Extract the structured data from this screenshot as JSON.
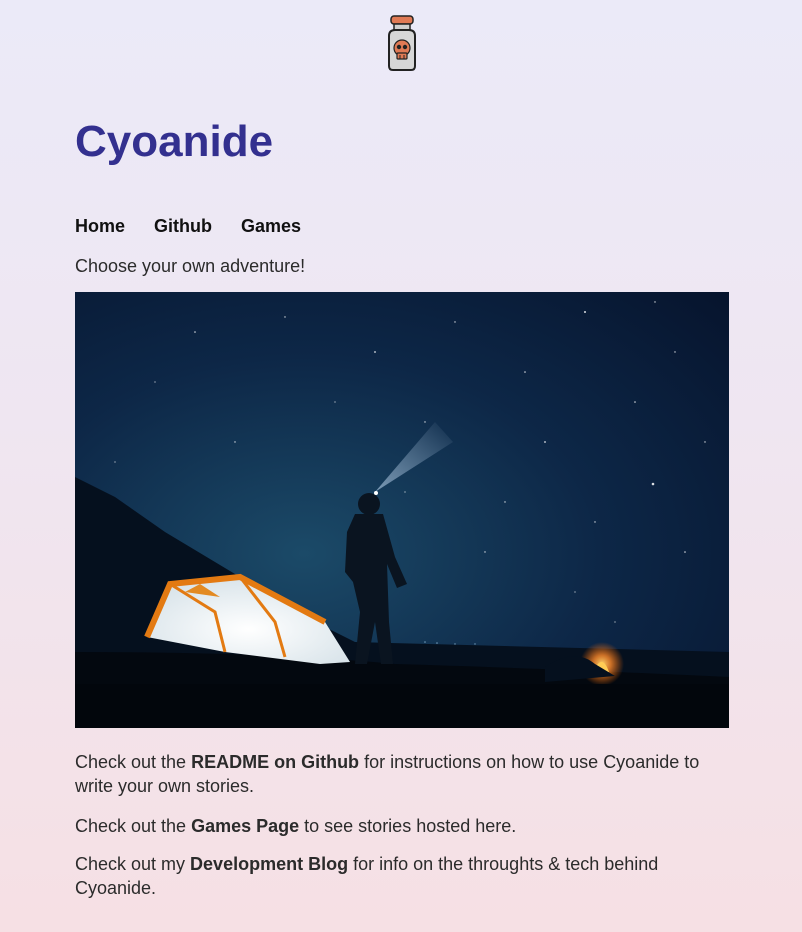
{
  "site": {
    "logo_icon": "poison-bottle-skull-icon",
    "title": "Cyoanide"
  },
  "nav": {
    "items": [
      {
        "label": "Home"
      },
      {
        "label": "Github"
      },
      {
        "label": "Games"
      }
    ]
  },
  "tagline": "Choose your own adventure!",
  "hero": {
    "icon": "night-camping-photo"
  },
  "paragraphs": [
    {
      "before": "Check out the ",
      "link": "README on Github",
      "after": " for instructions on how to use Cyoanide to write your own stories."
    },
    {
      "before": "Check out the ",
      "link": "Games Page",
      "after": " to see stories hosted here."
    },
    {
      "before": "Check out my ",
      "link": "Development Blog",
      "after": " for info on the throughts & tech behind Cyoanide."
    }
  ],
  "colors": {
    "title": "#33308f",
    "bottle_cap": "#e07a55",
    "skull": "#e07a55",
    "sky": "#0a1a35"
  }
}
